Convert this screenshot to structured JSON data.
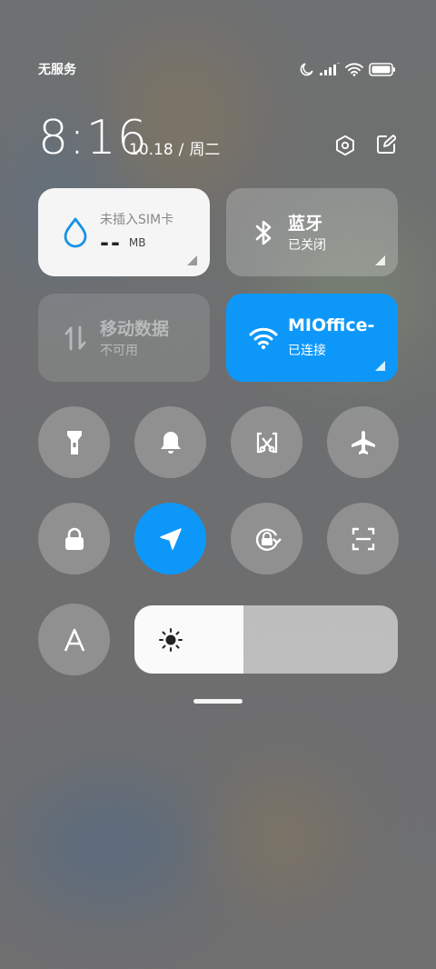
{
  "status": {
    "carrier": "无服务"
  },
  "clock": {
    "time": "8:16",
    "date": "10.18",
    "separator": "/",
    "weekday": "周二"
  },
  "tiles": {
    "data": {
      "title": "未插入SIM卡",
      "value": "--",
      "unit": "MB"
    },
    "bluetooth": {
      "title": "蓝牙",
      "sub": "已关闭"
    },
    "mobile": {
      "title": "移动数据",
      "sub": "不可用"
    },
    "wifi": {
      "title": "MIOffice-",
      "sub": "已连接"
    }
  },
  "toggles": [
    {
      "icon": "flashlight-icon",
      "active": false
    },
    {
      "icon": "bell-icon",
      "active": false
    },
    {
      "icon": "screenshot-icon",
      "active": false
    },
    {
      "icon": "airplane-icon",
      "active": false
    },
    {
      "icon": "lock-icon",
      "active": false
    },
    {
      "icon": "location-icon",
      "active": true
    },
    {
      "icon": "rotation-lock-icon",
      "active": false
    },
    {
      "icon": "scan-icon",
      "active": false
    },
    {
      "icon": "auto-brightness-icon",
      "active": false
    }
  ],
  "brightness": {
    "level": 0.415
  },
  "colors": {
    "accent": "#0d98f9",
    "tile_light": "#f5f5f5"
  }
}
